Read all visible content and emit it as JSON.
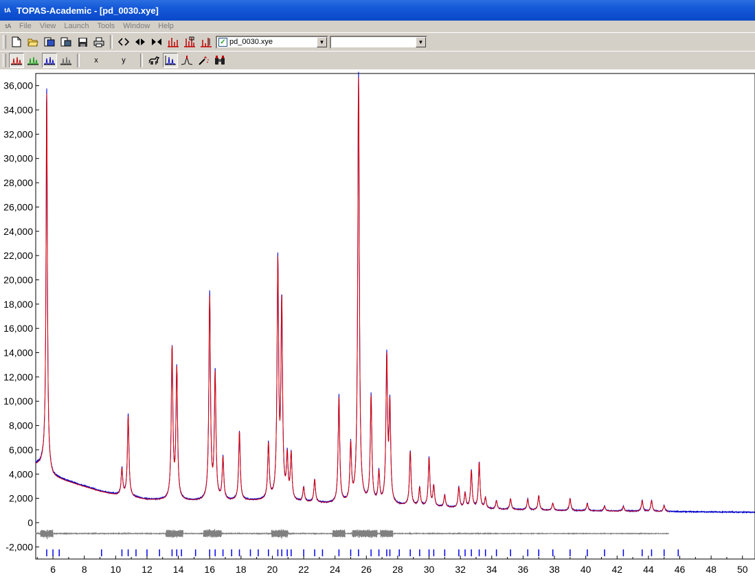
{
  "window": {
    "title": "TOPAS-Academic - [pd_0030.xye]",
    "app_icon": "tA"
  },
  "menu": {
    "mdi_icon": "tA",
    "items": [
      "File",
      "View",
      "Launch",
      "Tools",
      "Window",
      "Help"
    ]
  },
  "toolbar1": {
    "buttons": [
      "new-icon",
      "open-icon",
      "open-inp-icon",
      "open-xdd-icon",
      "save-icon",
      "print-icon",
      "scale-expand-icon",
      "scroll-icon",
      "scale-contract-icon",
      "peaks-fit-icon",
      "peaks-tag-icon",
      "peaks-scale-icon"
    ],
    "file_combo_value": "pd_0030.xye",
    "file_combo_checked": true,
    "second_combo_value": ""
  },
  "toolbar2": {
    "pattern_buttons": [
      "pattern-red-icon",
      "pattern-green-icon",
      "pattern-blue-icon",
      "pattern-gray-icon"
    ],
    "x_label": "x",
    "y_label": "y",
    "tool_buttons": [
      "horse-icon",
      "fit-peaks-icon",
      "peak-add-icon",
      "wand-icon",
      "binoculars-icon"
    ]
  },
  "chart_data": {
    "type": "line",
    "title": "",
    "xlabel": "",
    "ylabel": "",
    "xlim": [
      4.9,
      50.8
    ],
    "ylim": [
      -3000,
      37000
    ],
    "x_ticks": [
      6,
      8,
      10,
      12,
      14,
      16,
      18,
      20,
      22,
      24,
      26,
      28,
      30,
      32,
      34,
      36,
      38,
      40,
      42,
      44,
      46,
      48,
      50
    ],
    "y_ticks": [
      -2000,
      0,
      2000,
      4000,
      6000,
      8000,
      10000,
      12000,
      14000,
      16000,
      18000,
      20000,
      22000,
      24000,
      26000,
      28000,
      30000,
      32000,
      34000,
      36000
    ],
    "y_tick_labels": [
      "-2,000",
      "0",
      "2,000",
      "4,000",
      "6,000",
      "8,000",
      "10,000",
      "12,000",
      "14,000",
      "16,000",
      "18,000",
      "20,000",
      "22,000",
      "24,000",
      "26,000",
      "28,000",
      "30,000",
      "32,000",
      "34,000",
      "36,000"
    ],
    "grid": false,
    "series": [
      {
        "role": "observed",
        "color": "#0000cc",
        "background": [
          [
            4.9,
            4800
          ],
          [
            5.2,
            4850
          ],
          [
            5.5,
            5200
          ],
          [
            5.8,
            4200
          ],
          [
            6.0,
            3800
          ],
          [
            7.0,
            3400
          ],
          [
            8.0,
            3000
          ],
          [
            9.0,
            2600
          ],
          [
            10.0,
            2300
          ],
          [
            12.0,
            1900
          ],
          [
            14.0,
            1800
          ],
          [
            16.0,
            1750
          ],
          [
            18.0,
            1800
          ],
          [
            20.0,
            1800
          ],
          [
            22.0,
            1650
          ],
          [
            24.0,
            1550
          ],
          [
            26.0,
            1550
          ],
          [
            28.0,
            1400
          ],
          [
            30.0,
            1300
          ],
          [
            34.0,
            1100
          ],
          [
            38.0,
            1000
          ],
          [
            42.0,
            950
          ],
          [
            46.0,
            900
          ],
          [
            50.8,
            850
          ]
        ],
        "peaks": [
          [
            5.6,
            31000
          ],
          [
            10.4,
            2200
          ],
          [
            10.8,
            6700
          ],
          [
            13.6,
            12500
          ],
          [
            13.9,
            10800
          ],
          [
            16.0,
            16900
          ],
          [
            16.35,
            10400
          ],
          [
            16.85,
            3500
          ],
          [
            17.9,
            5700
          ],
          [
            19.75,
            4600
          ],
          [
            20.35,
            19500
          ],
          [
            20.6,
            16000
          ],
          [
            20.95,
            3500
          ],
          [
            21.2,
            3800
          ],
          [
            22.0,
            1200
          ],
          [
            22.7,
            1900
          ],
          [
            24.25,
            8800
          ],
          [
            25.0,
            4700
          ],
          [
            25.5,
            35500
          ],
          [
            26.3,
            8800
          ],
          [
            26.8,
            2500
          ],
          [
            27.3,
            12000
          ],
          [
            27.5,
            8000
          ],
          [
            28.8,
            4500
          ],
          [
            29.4,
            1500
          ],
          [
            30.0,
            4000
          ],
          [
            30.3,
            1700
          ],
          [
            31.0,
            1000
          ],
          [
            31.9,
            1700
          ],
          [
            32.3,
            1200
          ],
          [
            32.7,
            3100
          ],
          [
            33.2,
            3800
          ],
          [
            33.6,
            900
          ],
          [
            34.3,
            700
          ],
          [
            35.2,
            900
          ],
          [
            36.3,
            900
          ],
          [
            37.0,
            1200
          ],
          [
            37.9,
            600
          ],
          [
            39.0,
            1000
          ],
          [
            40.1,
            600
          ],
          [
            41.2,
            400
          ],
          [
            42.4,
            400
          ],
          [
            43.6,
            900
          ],
          [
            44.2,
            900
          ],
          [
            45.0,
            500
          ]
        ]
      },
      {
        "role": "calculated",
        "color": "#dd0000",
        "x_end": 45.3
      },
      {
        "role": "difference",
        "color": "#808080",
        "baseline": -900,
        "x_end": 45.3
      },
      {
        "role": "hkl_ticks",
        "color": "#0000ee",
        "positions": [
          5.6,
          6.0,
          6.4,
          9.1,
          10.4,
          10.8,
          11.3,
          12.0,
          12.8,
          13.6,
          13.9,
          14.2,
          15.1,
          16.0,
          16.35,
          16.85,
          17.4,
          17.9,
          18.6,
          19.1,
          19.75,
          20.35,
          20.6,
          20.95,
          21.2,
          22.0,
          22.7,
          23.2,
          24.25,
          25.0,
          25.5,
          26.3,
          26.8,
          27.3,
          27.5,
          28.1,
          28.8,
          29.4,
          30.0,
          30.3,
          31.0,
          31.9,
          32.3,
          32.7,
          33.2,
          33.6,
          34.3,
          35.2,
          36.3,
          37.0,
          37.9,
          39.0,
          40.1,
          41.2,
          42.4,
          43.6,
          44.2,
          45.0,
          45.9
        ]
      }
    ]
  }
}
